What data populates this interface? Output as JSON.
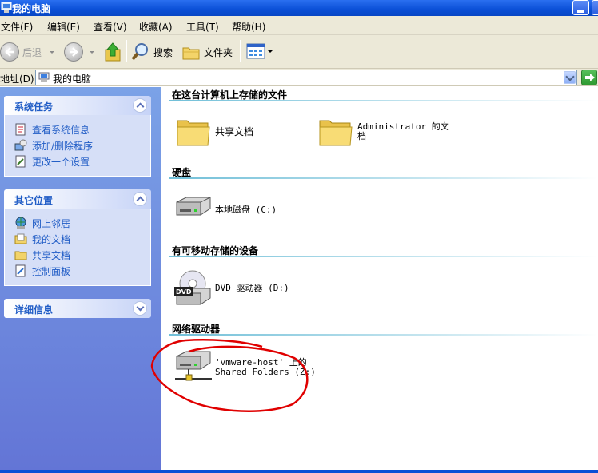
{
  "window": {
    "title": "我的电脑"
  },
  "menu": [
    "文件(F)",
    "编辑(E)",
    "查看(V)",
    "收藏(A)",
    "工具(T)",
    "帮助(H)"
  ],
  "toolbar": {
    "back": "后退",
    "search": "搜索",
    "folders": "文件夹"
  },
  "address": {
    "label": "地址(D)",
    "value": "我的电脑"
  },
  "left": {
    "tasks": {
      "title": "系统任务",
      "items": [
        "查看系统信息",
        "添加/删除程序",
        "更改一个设置"
      ]
    },
    "places": {
      "title": "其它位置",
      "items": [
        "网上邻居",
        "我的文档",
        "共享文档",
        "控制面板"
      ]
    },
    "details": {
      "title": "详细信息"
    }
  },
  "content": {
    "stored_files": {
      "title": "在这台计算机上存储的文件",
      "shared": "共享文档",
      "admin_line1": "Administrator 的文",
      "admin_line2": "档"
    },
    "hard_disks": {
      "title": "硬盘",
      "local_disk": "本地磁盘 (C:)"
    },
    "removable": {
      "title": "有可移动存储的设备",
      "dvd": "DVD 驱动器 (D:)"
    },
    "network": {
      "title": "网络驱动器",
      "line1": "'vmware-host' 上的",
      "line2": "Shared Folders (Z:)"
    }
  },
  "colors": {
    "annotation": "#e00000",
    "title_bar": "#0a4fd6",
    "left_pane": "#6f8ddf"
  }
}
